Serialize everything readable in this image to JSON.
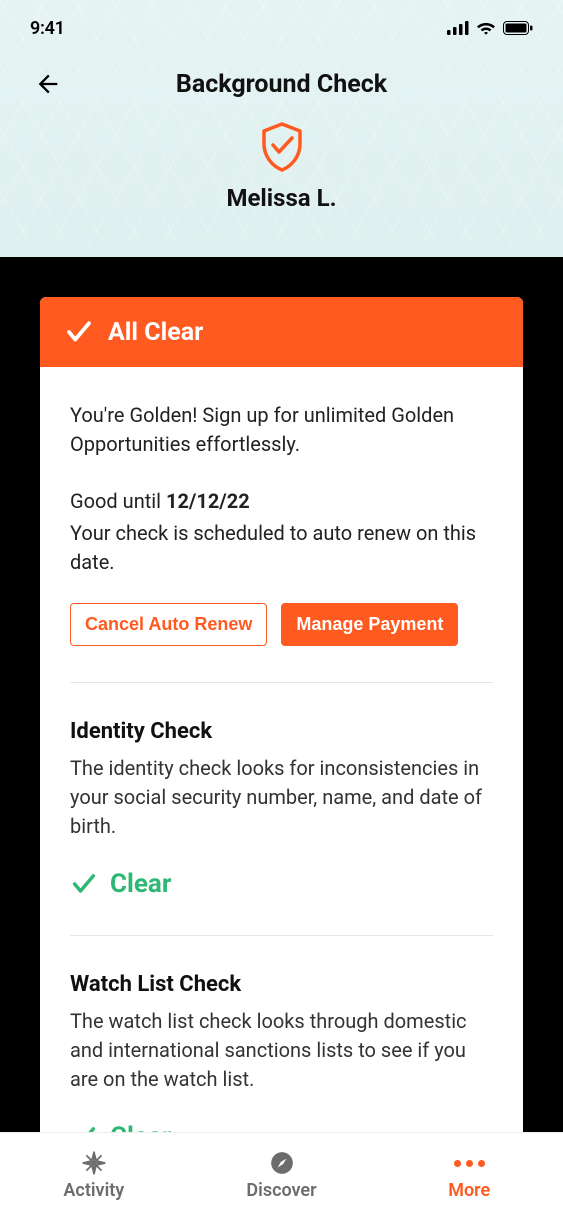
{
  "status": {
    "time": "9:41"
  },
  "header": {
    "title": "Background Check",
    "profile_name": "Melissa L."
  },
  "banner": {
    "title": "All Clear"
  },
  "main": {
    "lead": "You're Golden! Sign up for unlimited Golden Opportunities effortlessly.",
    "good_until_prefix": "Good until ",
    "good_until_date": "12/12/22",
    "renew_text": "Your check is scheduled to auto renew on this date.",
    "cancel_btn": "Cancel Auto Renew",
    "manage_btn": "Manage Payment"
  },
  "sections": {
    "identity": {
      "title": "Identity Check",
      "desc": "The identity check looks for inconsistencies in your social security number, name, and date of birth.",
      "status": "Clear"
    },
    "watchlist": {
      "title": "Watch List Check",
      "desc": "The watch list check looks through domestic and international sanctions lists to see if you are on the watch list.",
      "status": "Clear"
    }
  },
  "tabs": {
    "activity": "Activity",
    "discover": "Discover",
    "more": "More"
  },
  "colors": {
    "accent": "#ff5a1f",
    "success": "#2fb775"
  }
}
